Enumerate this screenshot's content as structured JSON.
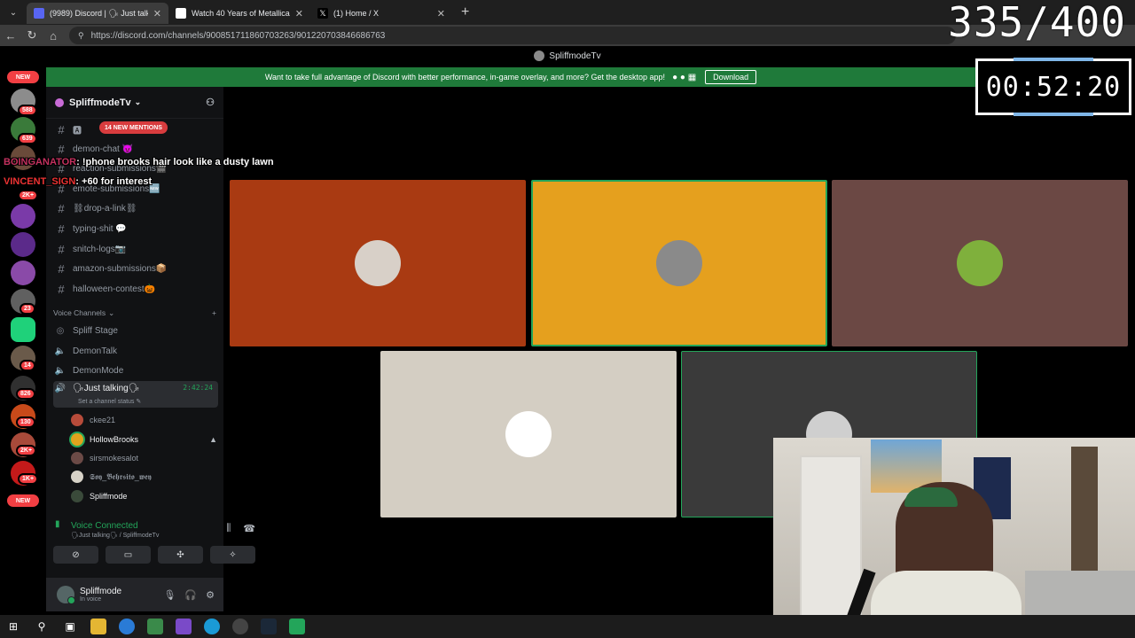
{
  "browser": {
    "tabs": [
      {
        "title": "(9989) Discord | 🗣 Just talking",
        "active": true,
        "favicon_color": "#5865f2"
      },
      {
        "title": "Watch 40 Years of Metallica, Night",
        "active": false,
        "favicon_color": "#ffffff"
      },
      {
        "title": "(1) Home / X",
        "active": false,
        "favicon_color": "#000000"
      }
    ],
    "url": "https://discord.com/channels/900851711860703263/901220703846686763"
  },
  "overlay": {
    "counter": "335/400",
    "timer": "00:52:20"
  },
  "discord": {
    "window_title": "SpliffmodeTv",
    "banner": {
      "text": "Want to take full advantage of Discord with better performance, in-game overlay, and more? Get the desktop app!",
      "download_label": "Download"
    },
    "server_rail": {
      "badges": [
        "NEW",
        "588",
        "639",
        "2K+",
        "23",
        "14",
        "826",
        "130",
        "2K+",
        "1K+",
        "NEW"
      ]
    },
    "server_name": "SpliffmodeTv",
    "mentions_pill": "14 NEW MENTIONS",
    "text_channels": [
      {
        "name": "🅰"
      },
      {
        "name": "demon-chat 😈"
      },
      {
        "name": "reaction-submissions🎬"
      },
      {
        "name": "emote-submissions🆕"
      },
      {
        "name": "⛓drop-a-link⛓"
      },
      {
        "name": "typing-shit 💬"
      },
      {
        "name": "snitch-logs📷"
      },
      {
        "name": "amazon-submissions📦"
      },
      {
        "name": "halloween-contest🎃"
      }
    ],
    "voice_header": "Voice Channels",
    "voice_channels": [
      {
        "name": "Spliff Stage"
      },
      {
        "name": "DemonTalk"
      },
      {
        "name": "DemonMode"
      }
    ],
    "active_voice": {
      "name": "🗣Just talking🗣",
      "time": "2:42:24",
      "status": "Set a channel status ✎"
    },
    "members": [
      {
        "name": "ckee21",
        "color": "#b74b3a"
      },
      {
        "name": "HollowBrooks",
        "color": "#e0a31d"
      },
      {
        "name": "sirsmokesalot",
        "color": "#6b4a46"
      },
      {
        "name": "𝕾𝖔𝖞_𝕭𝖊𝖍𝖗𝖘𝖎𝖙𝖔_𝖜𝖊𝖞",
        "color": "#d7d2c7"
      },
      {
        "name": "Spliffmode",
        "color": "#3a4a3a"
      }
    ],
    "voice_panel": {
      "status": "Voice Connected",
      "sub": "🗣Just talking🗣 / SpliffmodeTv"
    },
    "user": {
      "name": "Spliffmode",
      "status": "In voice"
    },
    "tiles": [
      {
        "bg": "#a93a12",
        "pfp": "#d8d0c8"
      },
      {
        "bg": "#e5a01e",
        "pfp": "#8a8a8a"
      },
      {
        "bg": "#6b4844",
        "pfp": "#7fb03c"
      },
      {
        "bg": "#d4cec3",
        "pfp": "#ffffff"
      },
      {
        "bg": "#3a3a3a",
        "pfp": "#cfcfcf"
      }
    ]
  },
  "chat_overlay": [
    {
      "user": "BOINGANATOR",
      "message": ": !phone brooks hair look like a dusty lawn"
    },
    {
      "user": "VINCENT_SIGN",
      "message": ": +60 for interest"
    }
  ]
}
